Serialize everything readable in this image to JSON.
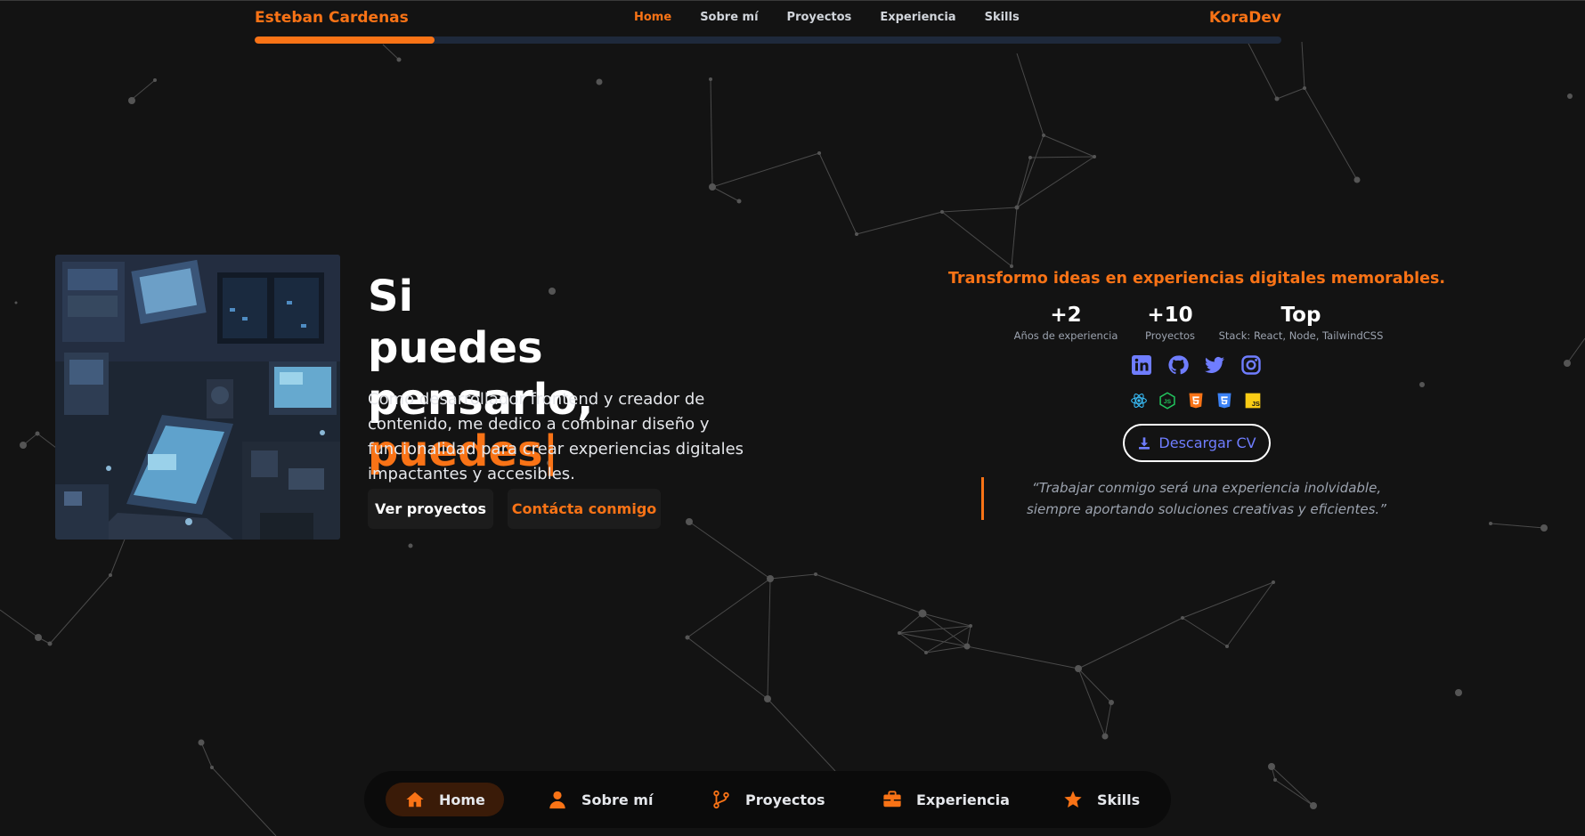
{
  "header": {
    "brand_left": "Esteban Cardenas",
    "brand_right": "KoraDev",
    "nav": [
      {
        "label": "Home",
        "active": true
      },
      {
        "label": "Sobre mí",
        "active": false
      },
      {
        "label": "Proyectos",
        "active": false
      },
      {
        "label": "Experiencia",
        "active": false
      },
      {
        "label": "Skills",
        "active": false
      }
    ],
    "scroll_progress_percent": 17.5
  },
  "hero": {
    "title_part1": "Si",
    "title_part2": "puedes",
    "title_part3": "pensarlo,",
    "title_accent": "puedes",
    "caret": "|",
    "description": "Como desarrollador frontend y creador de contenido, me dedico a combinar diseño y funcionalidad para crear experiencias digitales impactantes y accesibles.",
    "buttons": {
      "projects": "Ver proyectos",
      "contact": "Contácta conmigo"
    }
  },
  "profile": {
    "tagline": "Transformo ideas en experiencias digitales memorables.",
    "stats": [
      {
        "value": "+2",
        "label": "Años de experiencia"
      },
      {
        "value": "+10",
        "label": "Proyectos"
      },
      {
        "value": "Top",
        "label": "Stack: React, Node, TailwindCSS"
      }
    ],
    "social_icons": [
      "linkedin-icon",
      "github-icon",
      "twitter-icon",
      "instagram-icon"
    ],
    "tech_icons": [
      "react-icon",
      "nodejs-icon",
      "html5-icon",
      "css3-icon",
      "javascript-icon"
    ],
    "cv_button": "Descargar CV",
    "quote": "“Trabajar conmigo será una experiencia inolvidable, siempre aportando soluciones creativas y eficientes.”"
  },
  "dock": {
    "items": [
      {
        "label": "Home",
        "icon": "home-icon",
        "active": true
      },
      {
        "label": "Sobre mí",
        "icon": "user-icon",
        "active": false
      },
      {
        "label": "Proyectos",
        "icon": "branch-icon",
        "active": false
      },
      {
        "label": "Experiencia",
        "icon": "briefcase-icon",
        "active": false
      },
      {
        "label": "Skills",
        "icon": "star-icon",
        "active": false
      }
    ]
  },
  "colors": {
    "background": "#131313",
    "accent": "#f97316",
    "progress_track": "#1e293b",
    "social_icon": "#6f7dff",
    "dock_active": "#3a1b08"
  }
}
